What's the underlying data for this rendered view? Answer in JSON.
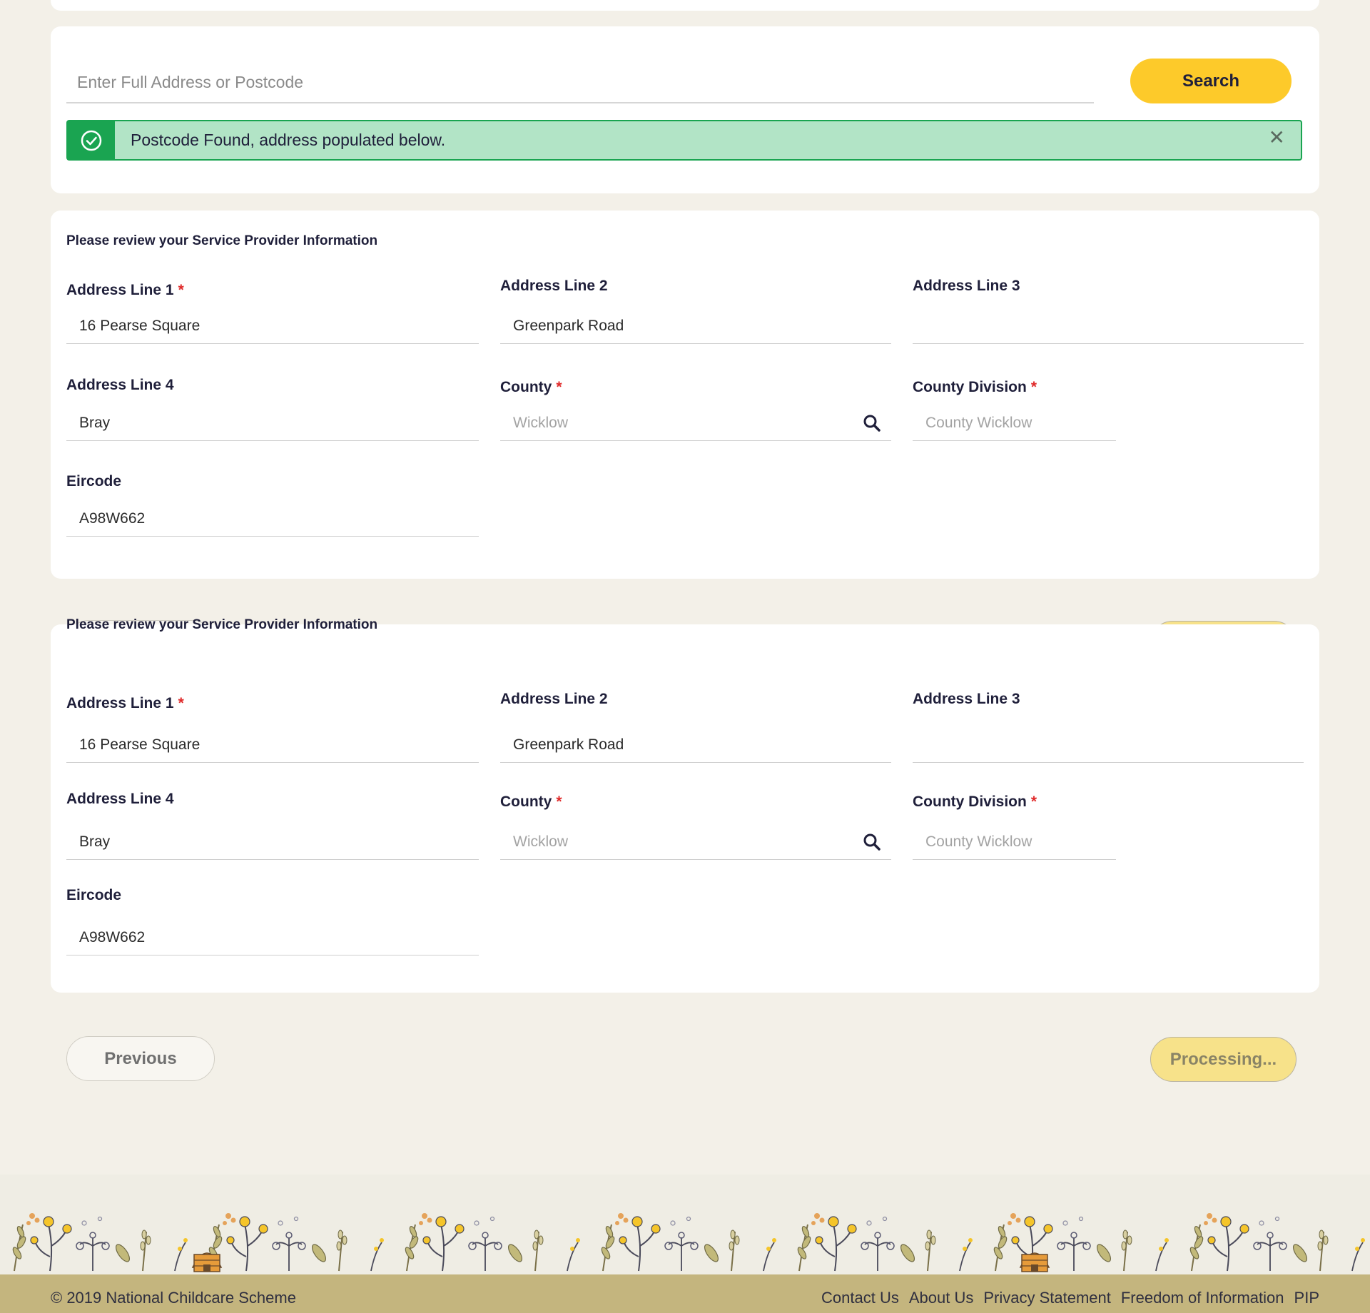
{
  "search": {
    "placeholder": "Enter Full Address or Postcode",
    "button_label": "Search"
  },
  "alert": {
    "message": "Postcode Found, address populated below.",
    "icon": "check-circle-icon",
    "close_icon": "close-icon",
    "color": "#1aa451"
  },
  "form": {
    "title": "Please review your Service Provider Information",
    "address_line_1": {
      "label": "Address Line 1",
      "required": "*",
      "value": "16 Pearse Square"
    },
    "address_line_2": {
      "label": "Address Line 2",
      "value": "Greenpark Road"
    },
    "address_line_3": {
      "label": "Address Line 3",
      "value": ""
    },
    "address_line_4": {
      "label": "Address Line 4",
      "value": "Bray"
    },
    "county": {
      "label": "County",
      "required": "*",
      "value": "Wicklow",
      "icon": "search-icon"
    },
    "county_division": {
      "label": "County Division",
      "required": "*",
      "value": "County Wicklow"
    },
    "eircode": {
      "label": "Eircode",
      "value": "A98W662"
    }
  },
  "nav": {
    "previous_label": "Previous",
    "processing_label": "Processing..."
  },
  "footer": {
    "copyright": "© 2019 National Childcare Scheme",
    "links": [
      "Contact Us",
      "About Us",
      "Privacy Statement",
      "Freedom of Information",
      "PIP"
    ]
  },
  "colors": {
    "page_bg": "#f3f0e8",
    "accent_yellow": "#fdca2a",
    "success_green": "#1aa451",
    "success_bg": "#b2e4c6",
    "required_red": "#e02a2a",
    "footer_bg": "#c4b57e"
  }
}
